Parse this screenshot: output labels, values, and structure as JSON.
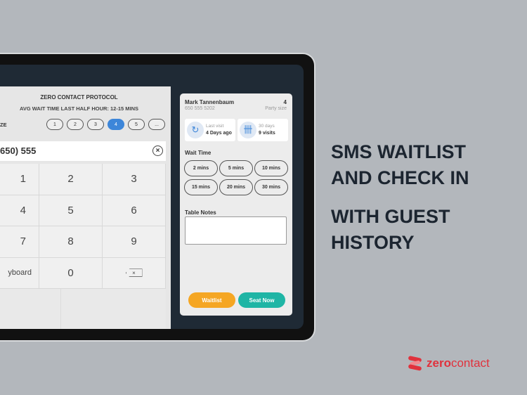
{
  "left_panel": {
    "title": "ZERO CONTACT PROTOCOL",
    "subtitle": "AVG WAIT TIME LAST HALF HOUR: 12-15 MINS",
    "party_label": "ZE",
    "party_options": [
      "1",
      "2",
      "3",
      "4",
      "5",
      "..."
    ],
    "party_selected": "4",
    "phone_value": "650) 555",
    "keys": [
      "1",
      "2",
      "3",
      "4",
      "5",
      "6",
      "7",
      "8",
      "9",
      "yboard",
      "0"
    ]
  },
  "guest_card": {
    "name": "Mark Tannenbaum",
    "phone": "650 555 5202",
    "party_size": "4",
    "party_size_label": "Party size",
    "last_visit_label": "Last visit",
    "last_visit_value": "4 Days ago",
    "visits_label": "30 days",
    "visits_value": "9 visits",
    "wait_time_label": "Wait Time",
    "wait_options": [
      "2 mins",
      "5 mins",
      "10 mins",
      "15 mins",
      "20 mins",
      "30 mins"
    ],
    "table_notes_label": "Table Notes",
    "waitlist_label": "Waitlist",
    "seat_now_label": "Seat Now"
  },
  "headline": {
    "line1": "SMS WAITLIST",
    "line2": "AND CHECK IN",
    "line3": "WITH GUEST",
    "line4": "HISTORY"
  },
  "logo": {
    "text_bold": "zero",
    "text_light": "contact"
  },
  "colors": {
    "accent_blue": "#3d86d9",
    "waitlist": "#f5a623",
    "seat_now": "#1fb5a5",
    "brand_red": "#e0323d",
    "headline": "#1c2530"
  }
}
